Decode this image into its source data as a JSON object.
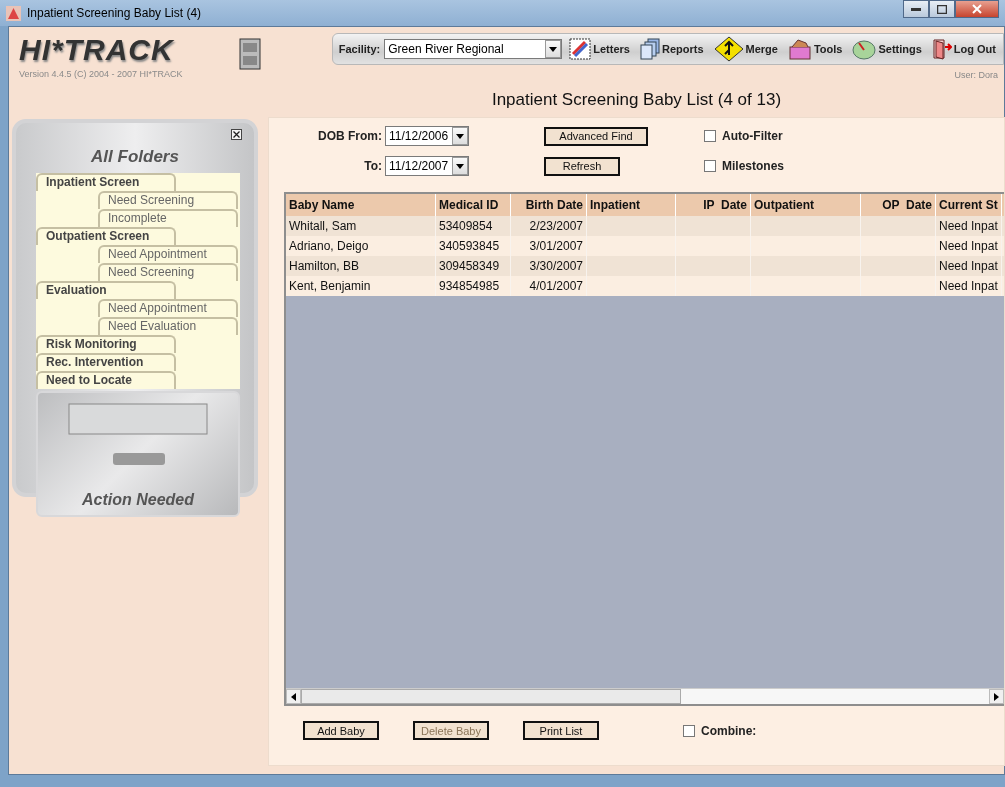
{
  "window": {
    "title": "Inpatient Screening Baby List (4)"
  },
  "header": {
    "logo": "HI*TRACK",
    "version": "Version 4.4.5 (C) 2004 - 2007 HI*TRACK",
    "user": "User: Dora"
  },
  "toolbar": {
    "facility_label": "Facility:",
    "facility_value": "Green River Regional",
    "items": [
      "Letters",
      "Reports",
      "Merge",
      "Tools",
      "Settings",
      "Log Out"
    ]
  },
  "page_title": "Inpatient Screening Baby List (4 of 13)",
  "sidebar": {
    "title": "All Folders",
    "folders": [
      {
        "label": "Inpatient Screen",
        "children": [
          {
            "label": "Need Screening"
          },
          {
            "label": "Incomplete"
          }
        ]
      },
      {
        "label": "Outpatient Screen",
        "children": [
          {
            "label": "Need Appointment"
          },
          {
            "label": "Need Screening"
          }
        ]
      },
      {
        "label": "Evaluation",
        "children": [
          {
            "label": "Need Appointment"
          },
          {
            "label": "Need Evaluation"
          }
        ]
      },
      {
        "label": "Risk Monitoring"
      },
      {
        "label": "Rec. Intervention"
      },
      {
        "label": "Need to Locate"
      }
    ],
    "drawer_label": "Action Needed"
  },
  "filters": {
    "from_label": "DOB From:",
    "from_value": "11/12/2006",
    "to_label": "To:",
    "to_value": "11/12/2007",
    "buttons": [
      "Advanced Find",
      "Refresh"
    ],
    "checkboxes": [
      {
        "label": "Auto-Filter",
        "checked": false
      },
      {
        "label": "Milestones",
        "checked": false
      }
    ]
  },
  "table": {
    "columns": [
      "Baby Name",
      "Medical ID",
      "Birth Date",
      "Inpatient",
      "IP  Date",
      "Outpatient",
      "OP  Date",
      "Current St"
    ],
    "rows": [
      {
        "baby_name": "Whitall, Sam",
        "medical_id": "53409854",
        "birth_date": "2/23/2007",
        "current_status": "Need Inpat"
      },
      {
        "baby_name": "Adriano, Deigo",
        "medical_id": "340593845",
        "birth_date": "3/01/2007",
        "current_status": "Need Inpat"
      },
      {
        "baby_name": "Hamilton, BB",
        "medical_id": "309458349",
        "birth_date": "3/30/2007",
        "current_status": "Need Inpat"
      },
      {
        "baby_name": "Kent, Benjamin",
        "medical_id": "934854985",
        "birth_date": "4/01/2007",
        "current_status": "Need Inpat"
      }
    ]
  },
  "footer": {
    "buttons": [
      {
        "label": "Add Baby",
        "disabled": false
      },
      {
        "label": "Delete Baby",
        "disabled": true
      },
      {
        "label": "Print List",
        "disabled": false
      }
    ],
    "combine": {
      "label": "Combine:",
      "checked": false
    }
  }
}
